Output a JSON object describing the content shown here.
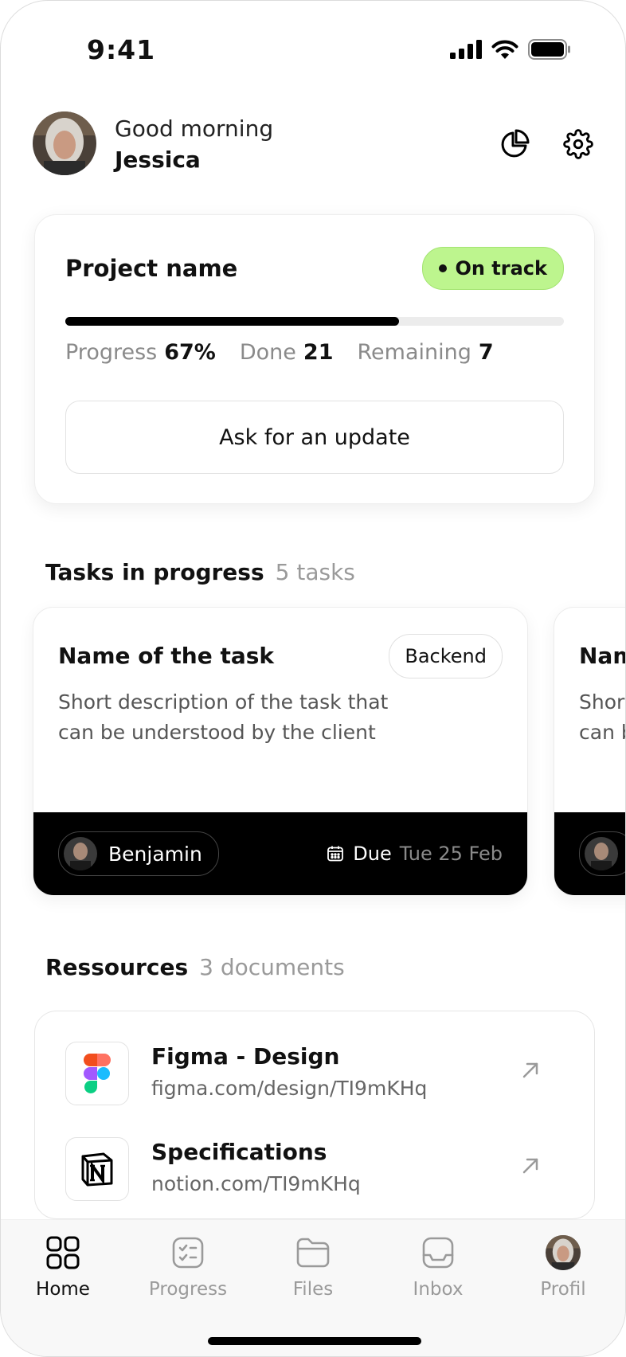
{
  "status": {
    "time": "9:41"
  },
  "header": {
    "greeting": "Good morning",
    "user_name": "Jessica"
  },
  "project": {
    "name": "Project name",
    "status_badge": "On track",
    "progress_fraction": 0.67,
    "stats": {
      "progress_label": "Progress",
      "progress_value": "67%",
      "done_label": "Done",
      "done_value": "21",
      "remaining_label": "Remaining",
      "remaining_value": "7"
    },
    "update_button": "Ask for an update"
  },
  "tasks": {
    "title": "Tasks in progress",
    "count": "5 tasks",
    "items": [
      {
        "title": "Name of the task",
        "tag": "Backend",
        "description": "Short description of the task that can be understood by the client",
        "assignee": "Benjamin",
        "due_label": "Due",
        "due_date": "Tue 25 Feb"
      },
      {
        "title": "Name of the task",
        "description": "Short description of the task that can be understood by the client"
      }
    ]
  },
  "resources": {
    "title": "Ressources",
    "count": "3 documents",
    "items": [
      {
        "title": "Figma - Design",
        "url": "figma.com/design/TI9mKHq",
        "icon": "figma-icon"
      },
      {
        "title": "Specifications",
        "url": "notion.com/TI9mKHq",
        "icon": "notion-icon"
      }
    ]
  },
  "tabbar": {
    "items": [
      {
        "label": "Home",
        "icon": "home-grid-icon",
        "active": true
      },
      {
        "label": "Progress",
        "icon": "checklist-icon"
      },
      {
        "label": "Files",
        "icon": "folder-icon"
      },
      {
        "label": "Inbox",
        "icon": "inbox-icon"
      },
      {
        "label": "Profil",
        "icon": "avatar"
      }
    ]
  },
  "colors": {
    "accent_green": "#bdf58e",
    "dark": "#000000",
    "muted": "#9a9a9a"
  }
}
